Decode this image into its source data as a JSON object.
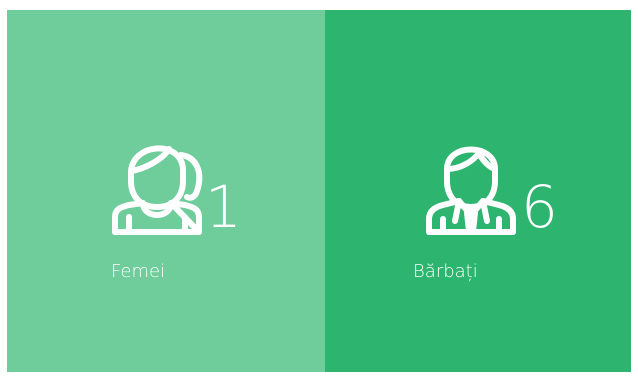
{
  "theme": {
    "female_bg": "#6fcc9b",
    "male_bg": "#2db46e",
    "foreground": "#ffffff"
  },
  "stats": {
    "female": {
      "icon": "female-user-icon",
      "count": "1",
      "label": "Femei"
    },
    "male": {
      "icon": "male-user-icon",
      "count": "6",
      "label": "Bărbați"
    }
  }
}
